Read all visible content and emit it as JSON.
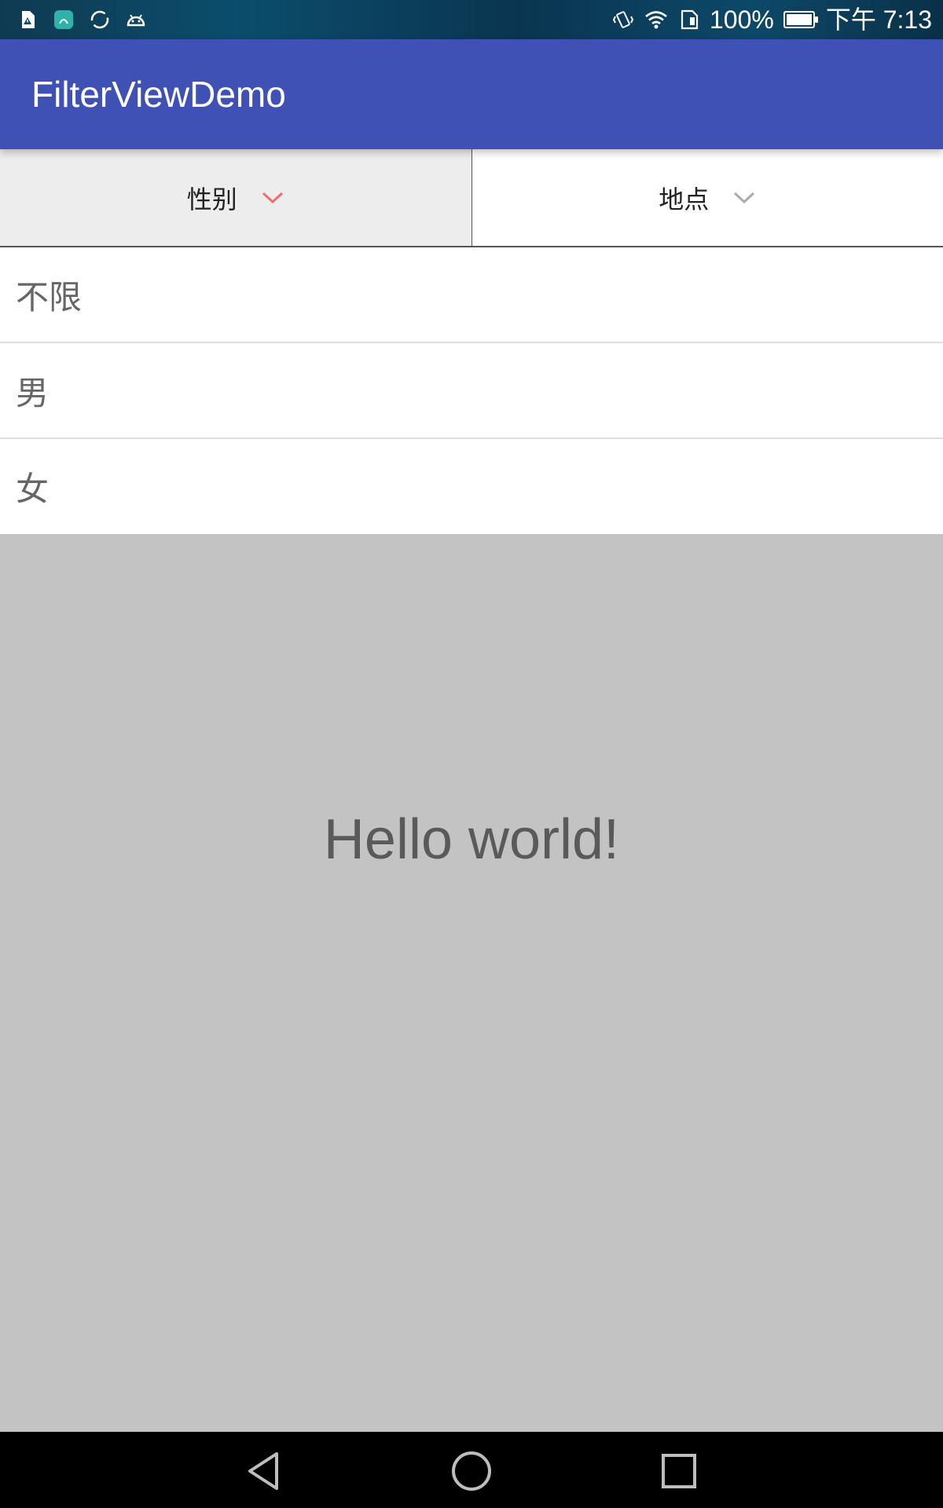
{
  "status_bar": {
    "icons_left": [
      "sim-alert-icon",
      "huawei-app-icon",
      "sync-icon",
      "android-icon"
    ],
    "icons_right": [
      "vibrate-icon",
      "wifi-icon",
      "sim-card-icon",
      "battery-icon"
    ],
    "battery_percent": "100%",
    "battery_level": 1.0,
    "time": "下午 7:13"
  },
  "app_bar": {
    "title": "FilterViewDemo",
    "color": "#3f51b5"
  },
  "filter_tabs": [
    {
      "label": "性别",
      "active": true,
      "chevron_color": "#f26b6b"
    },
    {
      "label": "地点",
      "active": false,
      "chevron_color": "#aaaaaa"
    }
  ],
  "options": [
    {
      "label": "不限"
    },
    {
      "label": "男"
    },
    {
      "label": "女"
    }
  ],
  "content": {
    "text": "Hello world!"
  },
  "nav_bar": {
    "buttons": [
      "back-icon",
      "home-icon",
      "recent-apps-icon"
    ]
  }
}
